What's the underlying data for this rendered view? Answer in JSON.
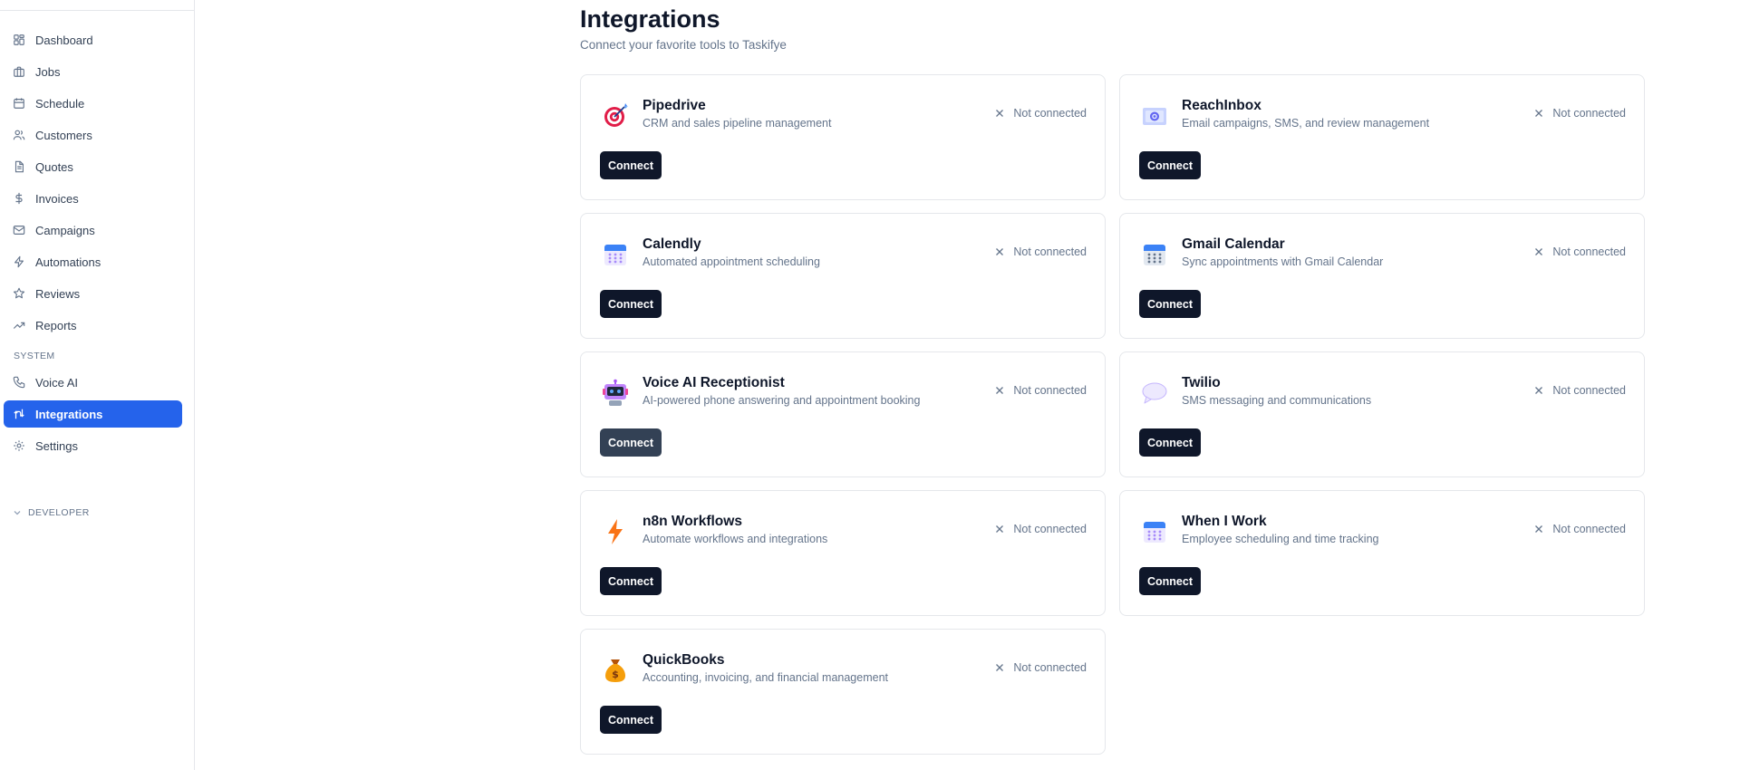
{
  "sidebar": {
    "nav": [
      {
        "label": "Dashboard",
        "icon": "dashboard-icon"
      },
      {
        "label": "Jobs",
        "icon": "briefcase-icon"
      },
      {
        "label": "Schedule",
        "icon": "calendar-icon"
      },
      {
        "label": "Customers",
        "icon": "users-icon"
      },
      {
        "label": "Quotes",
        "icon": "document-icon"
      },
      {
        "label": "Invoices",
        "icon": "dollar-icon"
      },
      {
        "label": "Campaigns",
        "icon": "mail-icon"
      },
      {
        "label": "Automations",
        "icon": "lightning-icon"
      },
      {
        "label": "Reviews",
        "icon": "star-icon"
      },
      {
        "label": "Reports",
        "icon": "trending-up-icon"
      }
    ],
    "system_label": "SYSTEM",
    "system": [
      {
        "label": "Voice AI",
        "icon": "phone-icon"
      },
      {
        "label": "Integrations",
        "icon": "integrations-icon",
        "active": true
      },
      {
        "label": "Settings",
        "icon": "gear-icon"
      }
    ],
    "developer_label": "DEVELOPER"
  },
  "page": {
    "title": "Integrations",
    "subtitle": "Connect your favorite tools to Taskifye"
  },
  "integrations": [
    {
      "name": "Pipedrive",
      "description": "CRM and sales pipeline management",
      "status": "Not connected",
      "button": "Connect",
      "logo": "target-icon"
    },
    {
      "name": "ReachInbox",
      "description": "Email campaigns, SMS, and review management",
      "status": "Not connected",
      "button": "Connect",
      "logo": "inbox-icon"
    },
    {
      "name": "Calendly",
      "description": "Automated appointment scheduling",
      "status": "Not connected",
      "button": "Connect",
      "logo": "calendar-icon"
    },
    {
      "name": "Gmail Calendar",
      "description": "Sync appointments with Gmail Calendar",
      "status": "Not connected",
      "button": "Connect",
      "logo": "calendar-icon"
    },
    {
      "name": "Voice AI Receptionist",
      "description": "AI-powered phone answering and appointment booking",
      "status": "Not connected",
      "button": "Connect",
      "logo": "robot-icon"
    },
    {
      "name": "Twilio",
      "description": "SMS messaging and communications",
      "status": "Not connected",
      "button": "Connect",
      "logo": "speech-bubble-icon"
    },
    {
      "name": "n8n Workflows",
      "description": "Automate workflows and integrations",
      "status": "Not connected",
      "button": "Connect",
      "logo": "lightning-icon"
    },
    {
      "name": "When I Work",
      "description": "Employee scheduling and time tracking",
      "status": "Not connected",
      "button": "Connect",
      "logo": "calendar-icon"
    },
    {
      "name": "QuickBooks",
      "description": "Accounting, invoicing, and financial management",
      "status": "Not connected",
      "button": "Connect",
      "logo": "money-bag-icon"
    }
  ],
  "colors": {
    "accent": "#2563eb",
    "button": "#0f172a",
    "muted_text": "#64748b",
    "border": "#e5e7eb"
  }
}
